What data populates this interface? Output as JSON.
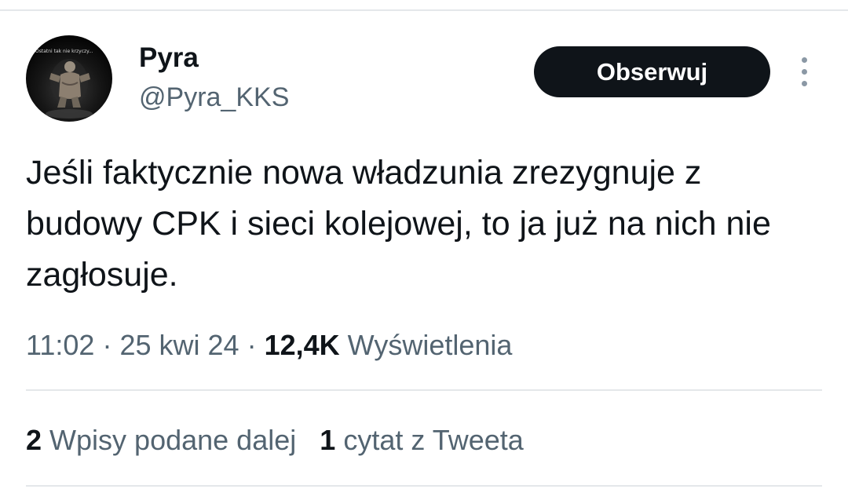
{
  "author": {
    "display_name": "Pyra",
    "handle": "@Pyra_KKS",
    "avatar_caption": "Ostatni tak nie krzyczy..."
  },
  "follow_button": {
    "label": "Obserwuj"
  },
  "more_icon": "vertical-ellipsis-icon",
  "tweet": {
    "text": "Jeśli faktycznie nowa władzunia zrezygnuje z budowy CPK i sieci kolejowej, to ja już na nich nie zagłosuje.",
    "time": "11:02",
    "date": "25 kwi 24",
    "separator": "·",
    "views_count": "12,4K",
    "views_label": "Wyświetlenia"
  },
  "stats": {
    "retweets_count": "2",
    "retweets_label": "Wpisy podane dalej",
    "quotes_count": "1",
    "quotes_label": "cytat z Tweeta"
  },
  "colors": {
    "text_primary": "#0f1419",
    "text_secondary": "#536471",
    "button_bg": "#0f1419",
    "divider": "#e4e7ea"
  }
}
